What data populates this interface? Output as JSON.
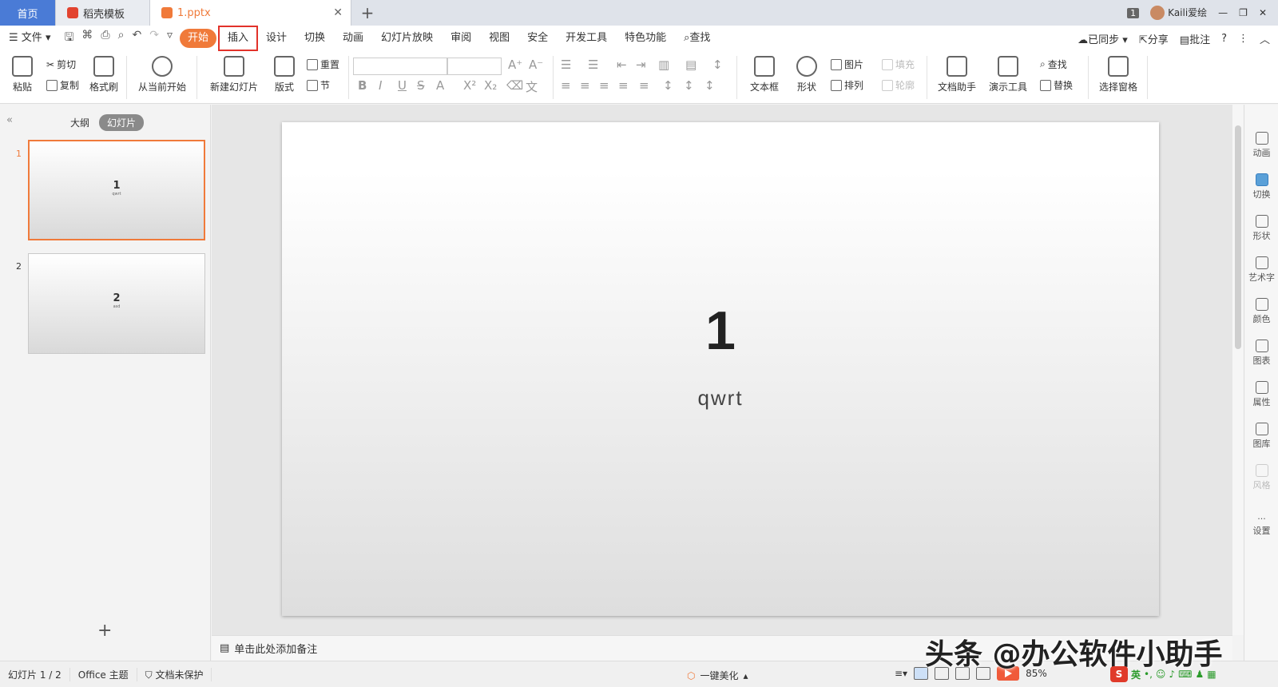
{
  "tabs": [
    {
      "label": "首页"
    },
    {
      "label": "稻壳模板"
    },
    {
      "label": "1.pptx"
    }
  ],
  "titlebar": {
    "count_badge": "1",
    "user_name": "Kaili爱绘"
  },
  "menu": {
    "file": "文件",
    "items": [
      "开始",
      "插入",
      "设计",
      "切换",
      "动画",
      "幻灯片放映",
      "审阅",
      "视图",
      "安全",
      "开发工具",
      "特色功能",
      "查找"
    ],
    "active": "开始",
    "highlighted": "插入",
    "sync": "已同步",
    "share": "分享",
    "comment": "批注",
    "help": "?"
  },
  "ribbon": {
    "paste": "粘贴",
    "cut": "剪切",
    "copy": "复制",
    "format_painter": "格式刷",
    "from_current": "从当前开始",
    "new_slide": "新建幻灯片",
    "layout": "版式",
    "reset": "重置",
    "section": "节",
    "textbox": "文本框",
    "shape": "形状",
    "picture": "图片",
    "fill": "填充",
    "arrange": "排列",
    "outline": "轮廓",
    "doc_assistant": "文档助手",
    "present_tools": "演示工具",
    "find": "查找",
    "replace": "替换",
    "selection_pane": "选择窗格"
  },
  "sidebar": {
    "tab_outline": "大纲",
    "tab_slides": "幻灯片",
    "slides": [
      {
        "num": "1",
        "title": "1",
        "subtitle": "qwrt",
        "selected": true
      },
      {
        "num": "2",
        "title": "2",
        "subtitle": "asd",
        "selected": false
      }
    ],
    "add": "+"
  },
  "slide": {
    "title": "1",
    "subtitle": "qwrt"
  },
  "notes_placeholder": "单击此处添加备注",
  "right_panel": [
    {
      "label": "动画"
    },
    {
      "label": "切换"
    },
    {
      "label": "形状"
    },
    {
      "label": "艺术字"
    },
    {
      "label": "颜色"
    },
    {
      "label": "图表"
    },
    {
      "label": "属性"
    },
    {
      "label": "图库"
    },
    {
      "label": "风格"
    },
    {
      "label": "设置"
    }
  ],
  "status": {
    "slide_pos": "幻灯片 1 / 2",
    "theme": "Office 主题",
    "protect": "文档未保护",
    "beautify": "一键美化",
    "zoom": "85%"
  },
  "watermark": "头条 @办公软件小助手",
  "ime": {
    "lang": "英"
  }
}
